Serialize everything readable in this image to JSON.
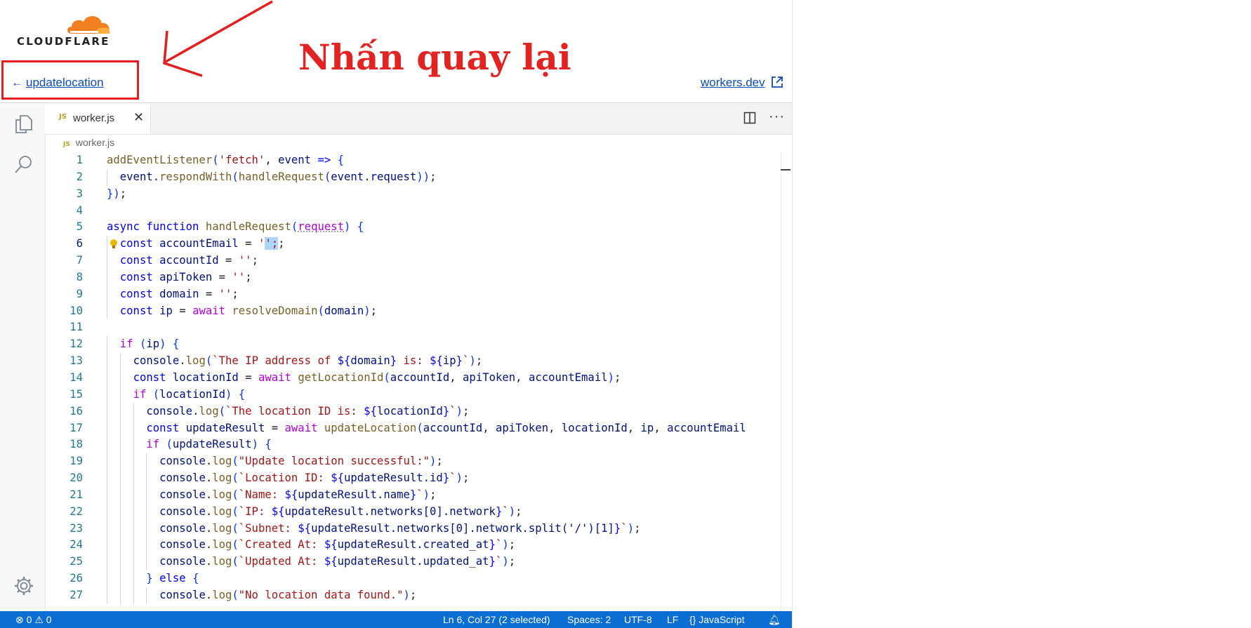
{
  "brand": {
    "name": "CLOUDFLARE"
  },
  "header": {
    "back_label": "updatelocation",
    "workers_link": "workers.dev"
  },
  "annotation": {
    "text": "Nhấn quay lại",
    "color": "#e32222"
  },
  "editor": {
    "tab_badge": "JS",
    "tab_name": "worker.js",
    "breadcrumb_badge": "JS",
    "breadcrumb": "worker.js",
    "current_line": 6,
    "lines": [
      "addEventListener('fetch', event => {",
      "  event.respondWith(handleRequest(event.request));",
      "});",
      "",
      "async function handleRequest(request) {",
      "  const accountEmail = '';",
      "  const accountId = '';",
      "  const apiToken = '';",
      "  const domain = '';",
      "  const ip = await resolveDomain(domain);",
      "",
      "  if (ip) {",
      "    console.log(`The IP address of ${domain} is: ${ip}`);",
      "    const locationId = await getLocationId(accountId, apiToken, accountEmail);",
      "    if (locationId) {",
      "      console.log(`The location ID is: ${locationId}`);",
      "      const updateResult = await updateLocation(accountId, apiToken, locationId, ip, accountEmail",
      "      if (updateResult) {",
      "        console.log(\"Update location successful:\");",
      "        console.log(`Location ID: ${updateResult.id}`);",
      "        console.log(`Name: ${updateResult.name}`);",
      "        console.log(`IP: ${updateResult.networks[0].network}`);",
      "        console.log(`Subnet: ${updateResult.networks[0].network.split('/')[1]}`);",
      "        console.log(`Created At: ${updateResult.created_at}`);",
      "        console.log(`Updated At: ${updateResult.updated_at}`);",
      "      } else {",
      "        console.log(\"No location data found.\");"
    ]
  },
  "status_bar": {
    "errors": "0",
    "warnings": "0",
    "cursor": "Ln 6, Col 27 (2 selected)",
    "spaces": "Spaces: 2",
    "encoding": "UTF-8",
    "eol": "LF",
    "language": "JavaScript"
  },
  "colors": {
    "status_bar": "#0b6ed2",
    "link": "#0a4bbd",
    "brand_orange": "#f38020"
  }
}
